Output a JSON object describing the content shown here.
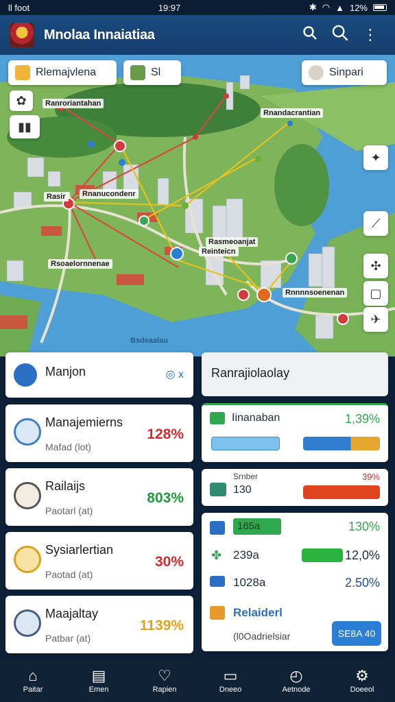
{
  "status": {
    "left": "ll foot",
    "time": "19:97",
    "battery": "12%"
  },
  "header": {
    "title": "Mnolaa Innaiatiaa",
    "icons": [
      "search-icon",
      "search-icon",
      "more-icon"
    ]
  },
  "map": {
    "chips": [
      {
        "label": "Rlemajvlena"
      },
      {
        "label": "Sl"
      },
      {
        "label": "Sinpari"
      }
    ],
    "labels": [
      "Ranroriantahan",
      "Rnandacrantian",
      "Rasir",
      "Rnanucondenr",
      "Rasmeoanjat",
      "Reinteicn",
      "Rsoaelornnenae",
      "Rnnnnsoenenan",
      "Bsdeaalau"
    ]
  },
  "list_cards": [
    {
      "title": "Manjon"
    },
    {
      "title": "Manajemierns",
      "sub": "Mafad (lot)",
      "pct": "128%",
      "color": "#d62b2b"
    },
    {
      "title": "Railaijs",
      "sub": "Paotarl (at)",
      "pct": "803%",
      "color": "#1e9b3a"
    },
    {
      "title": "Sysiarlertian",
      "sub": "Paotad (at)",
      "pct": "30%",
      "color": "#d62b2b"
    },
    {
      "title": "Maajaltay",
      "sub": "Patbar (at)",
      "pct": "1139%",
      "color": "#e3a31c"
    }
  ],
  "right_panel": {
    "header": "Ranrajiolaolay",
    "card1": {
      "label": "Iinanaban",
      "pct": "1,39%"
    },
    "card2": {
      "top": "Srnber",
      "value": "130",
      "pct": "39%"
    },
    "card3": {
      "rows": [
        {
          "value": "165a",
          "pct": "130%"
        },
        {
          "value": "239a",
          "pct": "12,0%"
        },
        {
          "value": "1028a",
          "pct": "2.50%"
        }
      ]
    },
    "card4": {
      "title": "Relaiderl",
      "sub": "(l0Oadrielsiar",
      "button": "SE8A 40"
    }
  },
  "nav": [
    {
      "label": "Paitar",
      "icon": "home-icon"
    },
    {
      "label": "Emen",
      "icon": "document-icon"
    },
    {
      "label": "Rapien",
      "icon": "heart-icon"
    },
    {
      "label": "Dneeo",
      "icon": "folder-icon"
    },
    {
      "label": "Aetnode",
      "icon": "compass-icon"
    },
    {
      "label": "Doeeol",
      "icon": "gear-icon"
    }
  ]
}
